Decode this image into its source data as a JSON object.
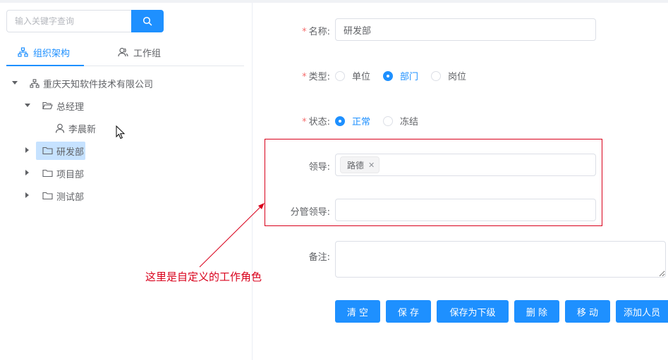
{
  "search": {
    "placeholder": "输入关键字查询",
    "button_icon": "search-icon"
  },
  "tabs": [
    {
      "label": "组织架构",
      "icon": "org-tree-icon",
      "active": true
    },
    {
      "label": "工作组",
      "icon": "users-icon",
      "active": false
    }
  ],
  "tree": [
    {
      "label": "重庆天知软件技术有限公司",
      "icon": "org-tree-icon",
      "expanded": true
    },
    {
      "label": "总经理",
      "icon": "folder-open-icon",
      "expanded": true
    },
    {
      "label": "李晨新",
      "icon": "user-icon"
    },
    {
      "label": "研发部",
      "icon": "folder-icon",
      "selected": true
    },
    {
      "label": "项目部",
      "icon": "folder-icon"
    },
    {
      "label": "测试部",
      "icon": "folder-icon"
    }
  ],
  "form": {
    "name_label": "名称:",
    "name_value": "研发部",
    "type_label": "类型:",
    "type_options": [
      "单位",
      "部门",
      "岗位"
    ],
    "type_selected": "部门",
    "status_label": "状态:",
    "status_options": [
      "正常",
      "冻结"
    ],
    "status_selected": "正常",
    "leader_label": "领导:",
    "leader_tags": [
      "路德"
    ],
    "sub_leader_label": "分管领导:",
    "remark_label": "备注:",
    "required_mark": "*"
  },
  "annotation": {
    "text": "这里是自定义的工作角色"
  },
  "buttons": [
    "清 空",
    "保 存",
    "保存为下级",
    "删 除",
    "移 动",
    "添加人员"
  ],
  "colors": {
    "primary": "#1e90ff",
    "annotation_red": "#d9001b",
    "required": "#f56c6c"
  }
}
